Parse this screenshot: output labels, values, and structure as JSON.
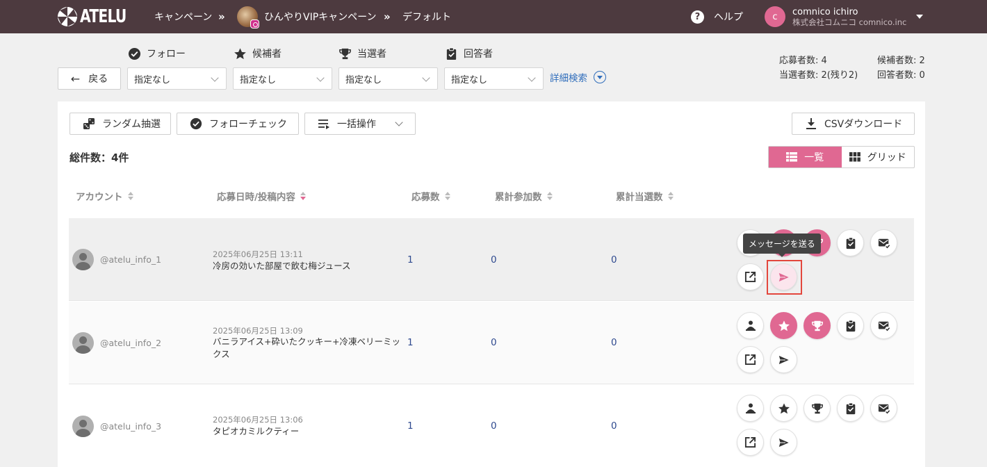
{
  "header": {
    "logo_text": "ATELU",
    "breadcrumb": {
      "campaigns": "キャンペーン",
      "sep": "»",
      "campaign_name": "ひんやりVIPキャンペーン",
      "view": "デフォルト"
    },
    "help_label": "ヘルプ",
    "help_glyph": "?",
    "user": {
      "initial": "c",
      "name": "comnico ichiro",
      "org": "株式会社コムニコ comnico.inc"
    }
  },
  "filters": {
    "back_label": "戻る",
    "back_arrow": "←",
    "labels": [
      {
        "label": "フォロー",
        "icon": "check-circle-icon"
      },
      {
        "label": "候補者",
        "icon": "star-icon"
      },
      {
        "label": "当選者",
        "icon": "trophy-icon"
      },
      {
        "label": "回答者",
        "icon": "clipboard-check-icon"
      }
    ],
    "selects": [
      "指定なし",
      "指定なし",
      "指定なし",
      "指定なし"
    ],
    "advanced_search": "詳細検索"
  },
  "stats": {
    "applicants": "応募者数: 4",
    "candidates": "候補者数: 2",
    "winners": "当選者数: 2(残り2)",
    "respondents": "回答者数: 0"
  },
  "toolbar": {
    "random_draw": "ランダム抽選",
    "follow_check": "フォローチェック",
    "bulk_action": "一括操作",
    "csv_download": "CSVダウンロード"
  },
  "total": "総件数：4件",
  "view_toggle": {
    "list": "一覧",
    "grid": "グリッド"
  },
  "columns": {
    "account": "アカウント",
    "posted": "応募日時/投稿内容",
    "entries": "応募数",
    "total_participation": "累計参加数",
    "total_wins": "累計当選数"
  },
  "rows": [
    {
      "account": "@atelu_info_1",
      "date": "2025年06月25日 13:11",
      "text": "冷房の効いた部屋で飲む梅ジュース",
      "entries": "1",
      "participation": "0",
      "wins": "0",
      "candidate": true,
      "winner": true
    },
    {
      "account": "@atelu_info_2",
      "date": "2025年06月25日 13:09",
      "text": "バニラアイス+砕いたクッキー+冷凍ベリーミックス",
      "entries": "1",
      "participation": "0",
      "wins": "0",
      "candidate": true,
      "winner": true
    },
    {
      "account": "@atelu_info_3",
      "date": "2025年06月25日 13:06",
      "text": "タピオカミルクティー",
      "entries": "1",
      "participation": "0",
      "wins": "0",
      "candidate": false,
      "winner": false
    }
  ],
  "tooltip": "メッセージを送る",
  "colors": {
    "header_bg": "#4d3a3f",
    "accent": "#e06892",
    "link": "#2f6dbb",
    "number": "#2f4a8f",
    "focus": "#e3473d"
  }
}
